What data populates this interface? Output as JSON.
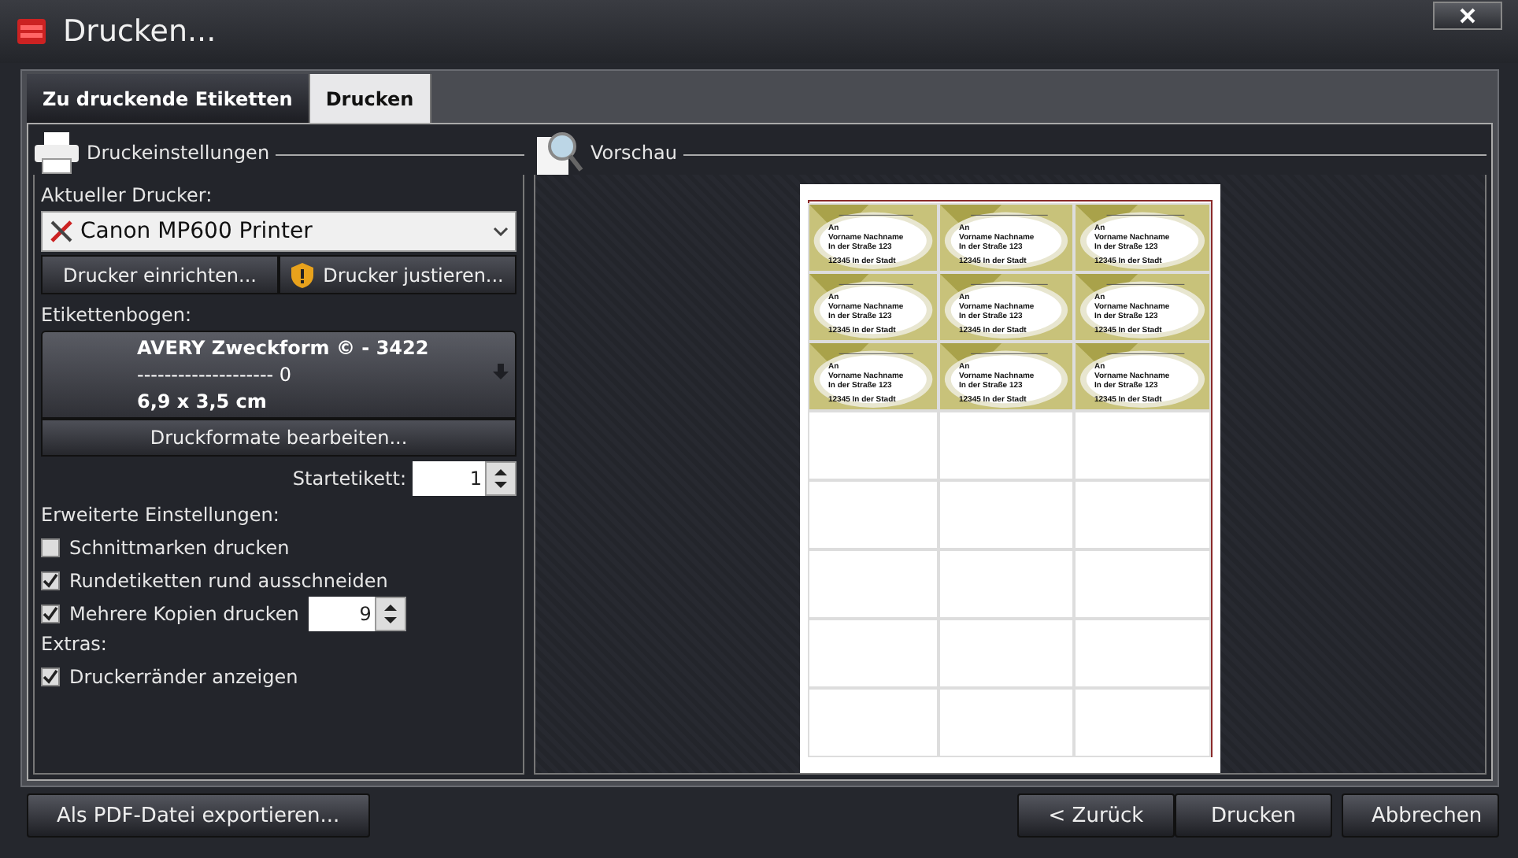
{
  "window": {
    "title": "Drucken..."
  },
  "tabs": [
    {
      "label": "Zu druckende Etiketten",
      "selected": false
    },
    {
      "label": "Drucken",
      "selected": true
    }
  ],
  "settings": {
    "title": "Druckeinstellungen",
    "printer_label": "Aktueller Drucker:",
    "printer": "Canon MP600 Printer",
    "setup_button": "Drucker einrichten...",
    "adjust_button": "Drucker justieren...",
    "sheet_label": "Etikettenbogen:",
    "sheet": {
      "name": "AVERY Zweckform © - 3422",
      "line": "-------------------- 0",
      "size": "6,9 x 3,5 cm"
    },
    "formats_button": "Druckformate bearbeiten...",
    "start_label": "Startetikett:",
    "start_value": "1",
    "advanced_label": "Erweiterte Einstellungen:",
    "options": [
      {
        "label": "Schnittmarken drucken",
        "checked": false
      },
      {
        "label": "Rundetiketten rund ausschneiden",
        "checked": true
      },
      {
        "label": "Mehrere Kopien drucken",
        "checked": true,
        "value": "9"
      }
    ],
    "extras_label": "Extras:",
    "extras": [
      {
        "label": "Druckerränder anzeigen",
        "checked": true
      }
    ]
  },
  "preview": {
    "title": "Vorschau",
    "labels": [
      {
        "kind": "address",
        "lines": [
          "An",
          "Vorname Nachname",
          "In der Straße 123",
          "12345 In der Stadt"
        ]
      },
      {
        "kind": "address",
        "lines": [
          "An",
          "Vorname Nachname",
          "In der Straße 123",
          "12345 In der Stadt"
        ]
      },
      {
        "kind": "address",
        "lines": [
          "An",
          "Vorname Nachname",
          "In der Straße 123",
          "12345 In der Stadt"
        ]
      },
      {
        "kind": "address",
        "lines": [
          "An",
          "Vorname Nachname",
          "In der Straße 123",
          "12345 In der Stadt"
        ]
      },
      {
        "kind": "address",
        "lines": [
          "An",
          "Vorname Nachname",
          "In der Straße 123",
          "12345 In der Stadt"
        ]
      },
      {
        "kind": "address",
        "lines": [
          "An",
          "Vorname Nachname",
          "In der Straße 123",
          "12345 In der Stadt"
        ]
      },
      {
        "kind": "address",
        "lines": [
          "An",
          "Vorname Nachname",
          "In der Straße 123",
          "12345 In der Stadt"
        ]
      },
      {
        "kind": "address",
        "lines": [
          "An",
          "Vorname Nachname",
          "In der Straße 123",
          "12345 In der Stadt"
        ]
      },
      {
        "kind": "address",
        "lines": [
          "An",
          "Vorname Nachname",
          "In der Straße 123",
          "12345 In der Stadt"
        ]
      },
      {
        "kind": "empty"
      },
      {
        "kind": "empty"
      },
      {
        "kind": "empty"
      },
      {
        "kind": "empty"
      },
      {
        "kind": "empty"
      },
      {
        "kind": "empty"
      },
      {
        "kind": "empty"
      },
      {
        "kind": "empty"
      },
      {
        "kind": "empty"
      },
      {
        "kind": "empty"
      },
      {
        "kind": "empty"
      },
      {
        "kind": "empty"
      },
      {
        "kind": "empty"
      },
      {
        "kind": "empty"
      },
      {
        "kind": "empty"
      }
    ]
  },
  "footer": {
    "export_button": "Als PDF-Datei exportieren...",
    "back_button": "< Zurück",
    "print_button": "Drucken",
    "cancel_button": "Abbrechen"
  }
}
